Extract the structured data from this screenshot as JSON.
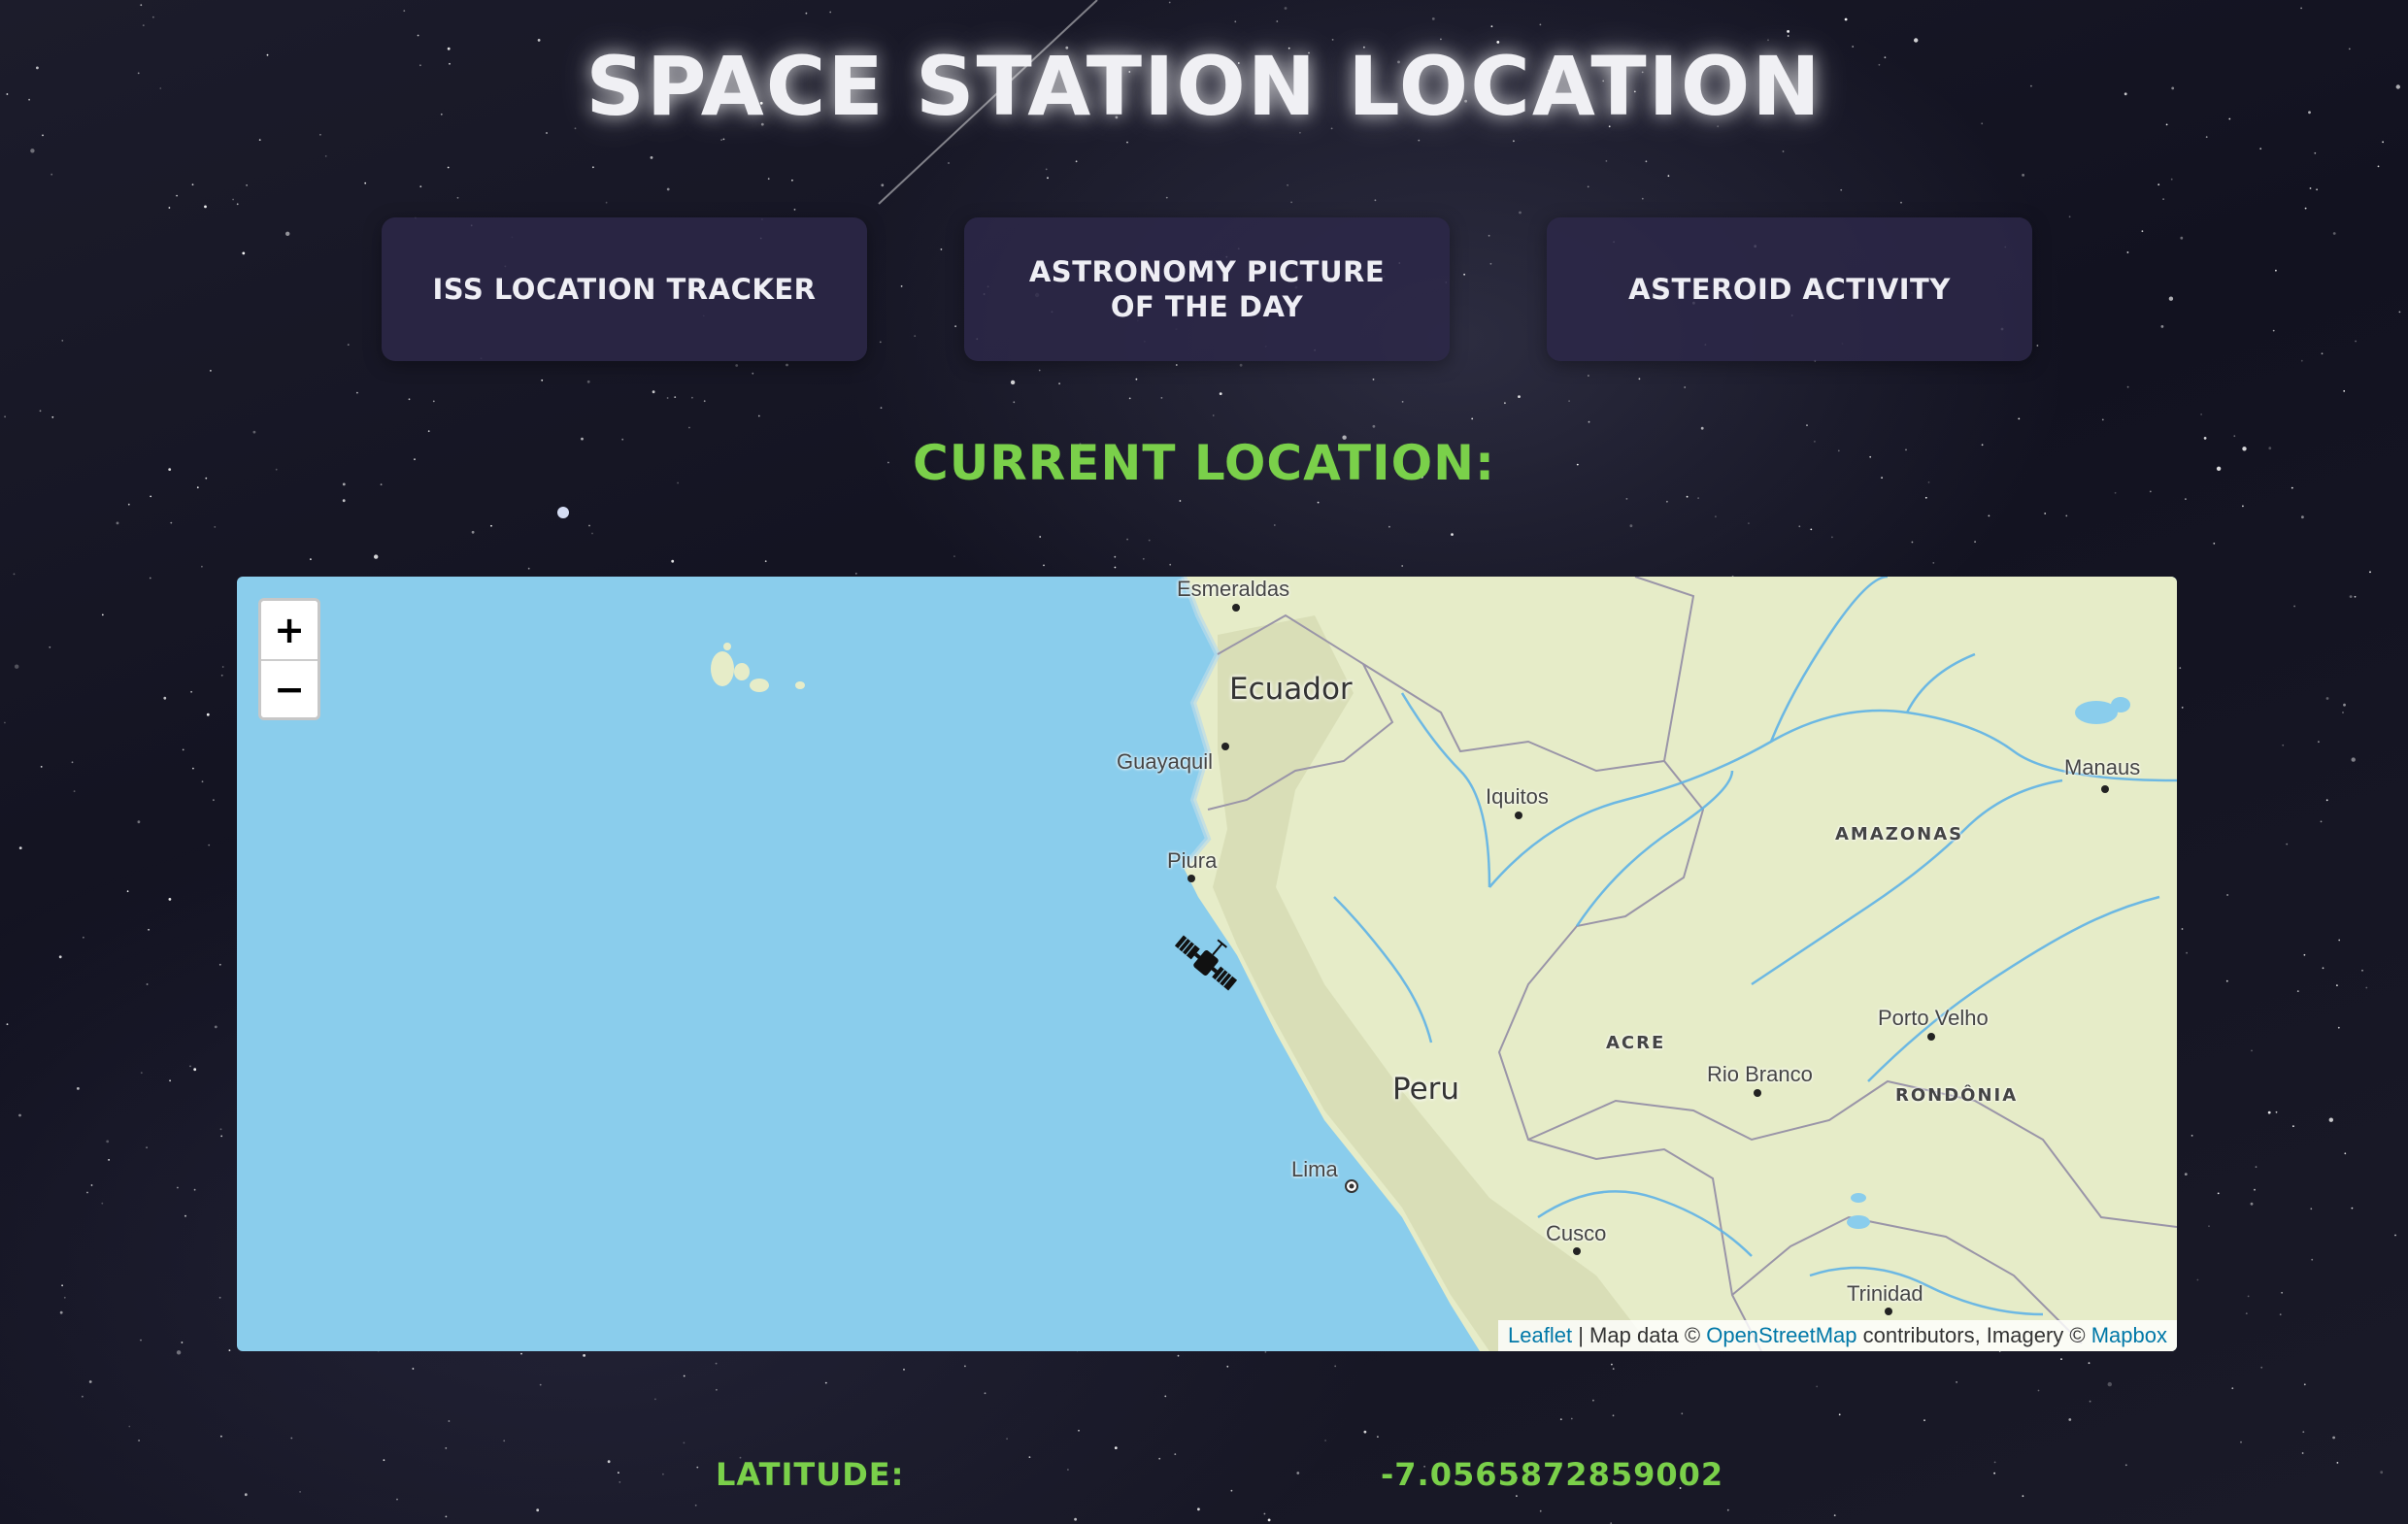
{
  "page": {
    "title": "Space Station Location",
    "subtitle": "Current Location:"
  },
  "nav": [
    {
      "label": "ISS Location Tracker"
    },
    {
      "label": "Astronomy Picture of the Day"
    },
    {
      "label": "Asteroid Activity"
    }
  ],
  "map": {
    "zoom_in": "+",
    "zoom_out": "−",
    "marker_icon": "satellite-icon",
    "countries": {
      "ecuador": "Ecuador",
      "peru": "Peru"
    },
    "cities": {
      "esmeraldas": "Esmeraldas",
      "guayaquil": "Guayaquil",
      "piura": "Piura",
      "iquitos": "Iquitos",
      "manaus": "Manaus",
      "porto_velho": "Porto Velho",
      "rio_branco": "Rio Branco",
      "lima": "Lima",
      "cusco": "Cusco",
      "trinidad": "Trinidad"
    },
    "regions": {
      "amazonas": "AMAZONAS",
      "acre": "ACRE",
      "rondonia": "RONDÔNIA"
    },
    "attribution": {
      "leaflet": "Leaflet",
      "sep": " | Map data © ",
      "osm": "OpenStreetMap",
      "mid": " contributors, Imagery © ",
      "mapbox": "Mapbox"
    },
    "colors": {
      "ocean": "#8acdec",
      "land": "#e6ecc8",
      "highlands": "#d6dcb4",
      "rivers": "#5fb3e6",
      "borders": "#9a95a8"
    }
  },
  "coords": {
    "latitude_label": "Latitude:",
    "latitude_value": "-7.0565872859002"
  },
  "colors": {
    "accent": "#7ad04a",
    "nav_bg": "#2c2848",
    "title": "#f0f0f4"
  }
}
